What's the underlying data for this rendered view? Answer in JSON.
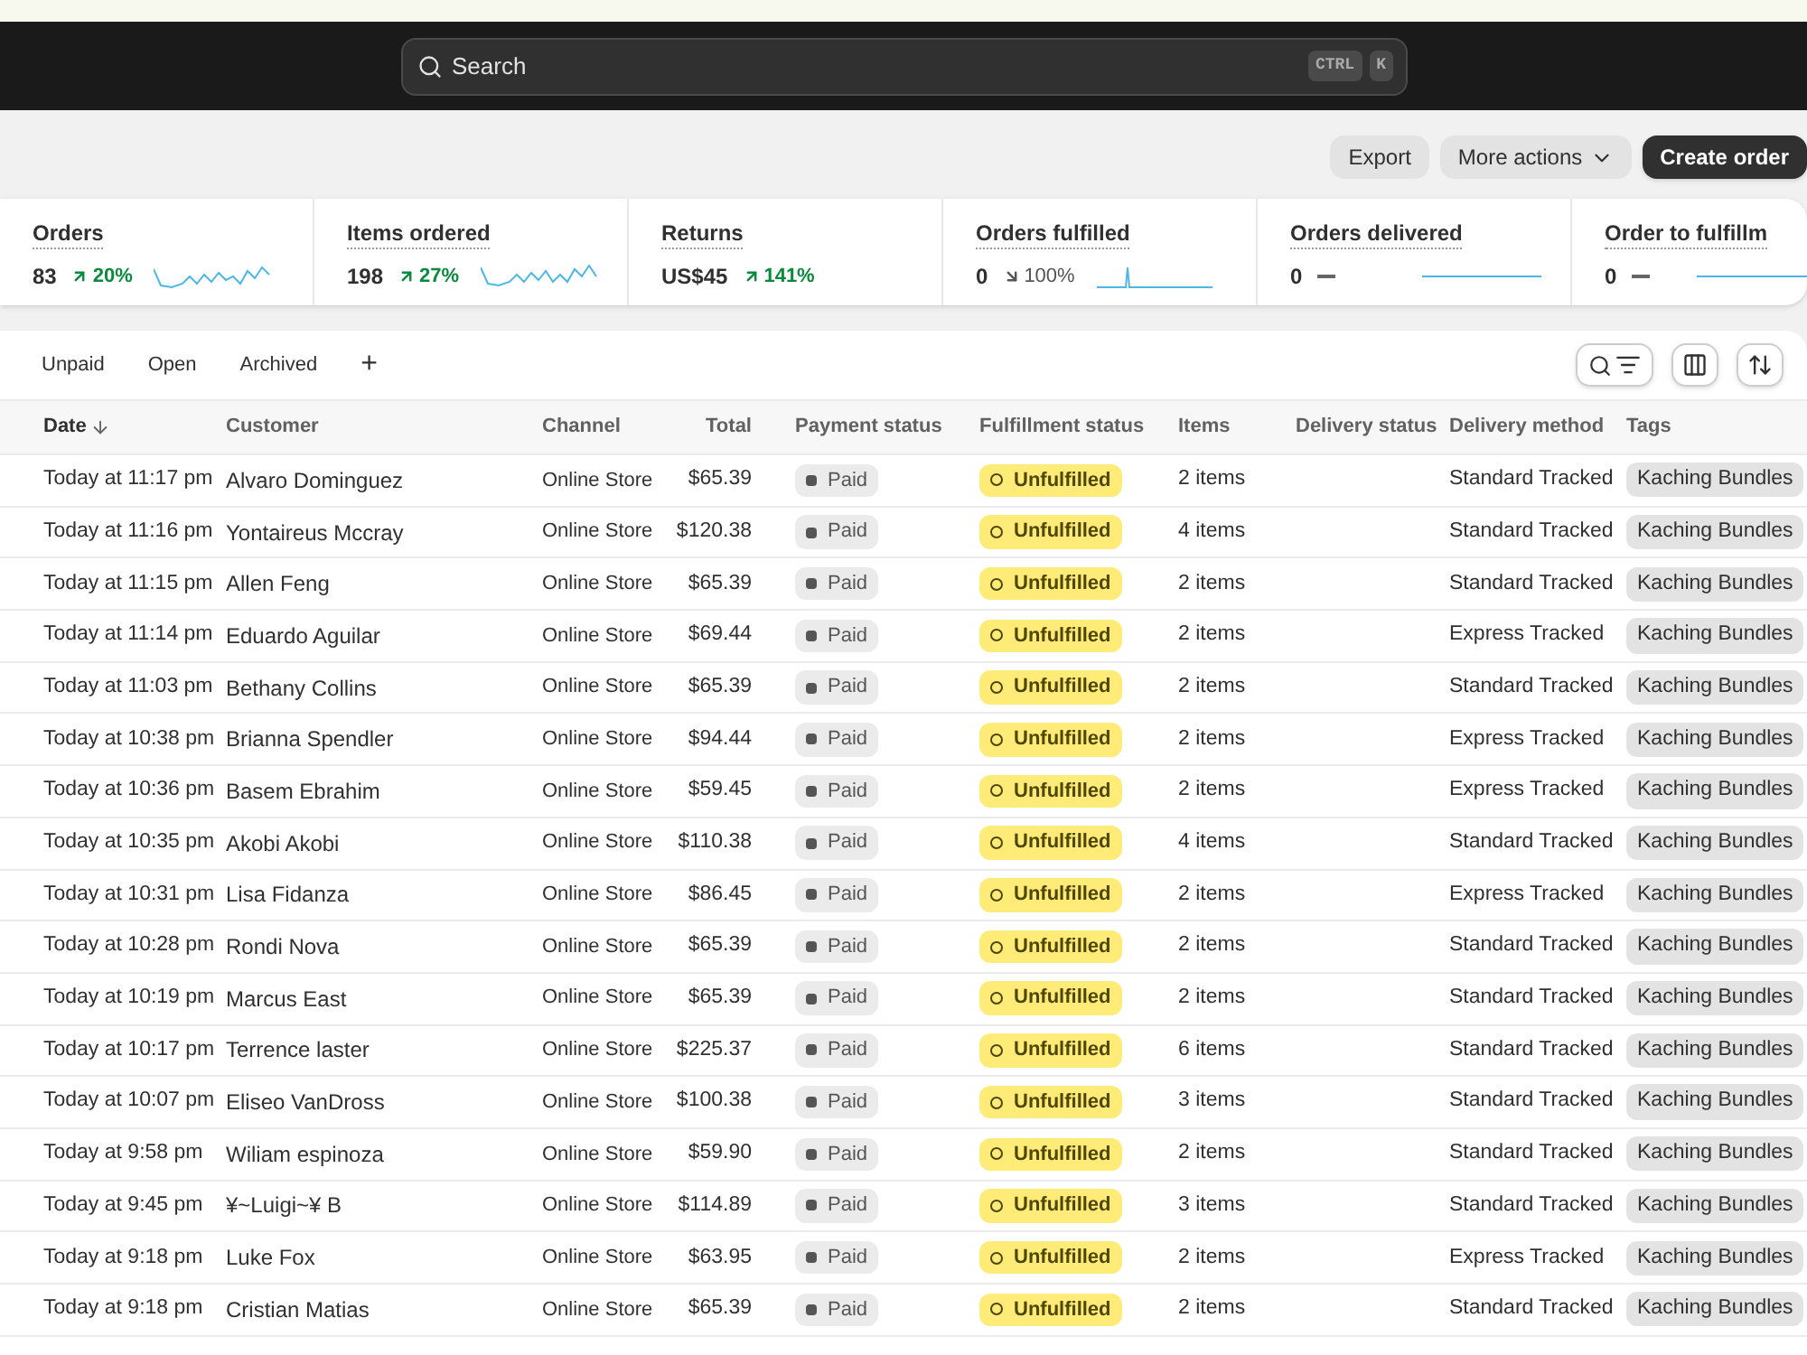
{
  "search": {
    "placeholder": "Search",
    "shortcut": [
      "CTRL",
      "K"
    ]
  },
  "actions": [
    {
      "label": "Export",
      "kind": "plain"
    },
    {
      "label": "More actions",
      "kind": "menu"
    },
    {
      "label": "Create order",
      "kind": "primary"
    }
  ],
  "metrics": [
    {
      "label": "Orders",
      "value": "83",
      "trend": {
        "kind": "up",
        "text": "20%"
      }
    },
    {
      "label": "Items ordered",
      "value": "198",
      "trend": {
        "kind": "up",
        "text": "27%"
      }
    },
    {
      "label": "Returns",
      "value": "US$45",
      "trend": {
        "kind": "up",
        "text": "141%"
      }
    },
    {
      "label": "Orders fulfilled",
      "value": "0",
      "trend": {
        "kind": "down",
        "text": "100%"
      }
    },
    {
      "label": "Orders delivered",
      "value": "0",
      "trend": {
        "kind": "none"
      }
    },
    {
      "label": "Order to fulfillm",
      "value": "0",
      "trend": {
        "kind": "none"
      }
    }
  ],
  "tabs": [
    {
      "label": "Unpaid",
      "selected": false
    },
    {
      "label": "Open",
      "selected": false
    },
    {
      "label": "Archived",
      "selected": false
    },
    {
      "label": "+",
      "selected": false
    }
  ],
  "table": {
    "columns": [
      {
        "label": "Date",
        "sorted": true
      },
      {
        "label": "Customer",
        "sorted": false
      },
      {
        "label": "Channel",
        "sorted": false
      },
      {
        "label": "Total",
        "sorted": false
      },
      {
        "label": "Payment status",
        "sorted": false
      },
      {
        "label": "Fulfillment status",
        "sorted": false
      },
      {
        "label": "Items",
        "sorted": false
      },
      {
        "label": "Delivery status",
        "sorted": false
      },
      {
        "label": "Delivery method",
        "sorted": false
      },
      {
        "label": "Tags",
        "sorted": false
      }
    ],
    "rows": [
      {
        "date": "Today at 11:17 pm",
        "customer": "Alvaro Dominguez",
        "channel": "Online Store",
        "total": "$65.39",
        "payment": "Paid",
        "fulfillment": "Unfulfilled",
        "items": "2 items",
        "method": "Standard Tracked",
        "tag": "Kaching Bundles"
      },
      {
        "date": "Today at 11:16 pm",
        "customer": "Yontaireus Mccray",
        "channel": "Online Store",
        "total": "$120.38",
        "payment": "Paid",
        "fulfillment": "Unfulfilled",
        "items": "4 items",
        "method": "Standard Tracked",
        "tag": "Kaching Bundles"
      },
      {
        "date": "Today at 11:15 pm",
        "customer": "Allen Feng",
        "channel": "Online Store",
        "total": "$65.39",
        "payment": "Paid",
        "fulfillment": "Unfulfilled",
        "items": "2 items",
        "method": "Standard Tracked",
        "tag": "Kaching Bundles"
      },
      {
        "date": "Today at 11:14 pm",
        "customer": "Eduardo Aguilar",
        "channel": "Online Store",
        "total": "$69.44",
        "payment": "Paid",
        "fulfillment": "Unfulfilled",
        "items": "2 items",
        "method": "Express Tracked",
        "tag": "Kaching Bundles"
      },
      {
        "date": "Today at 11:03 pm",
        "customer": "Bethany Collins",
        "channel": "Online Store",
        "total": "$65.39",
        "payment": "Paid",
        "fulfillment": "Unfulfilled",
        "items": "2 items",
        "method": "Standard Tracked",
        "tag": "Kaching Bundles"
      },
      {
        "date": "Today at 10:38 pm",
        "customer": "Brianna Spendler",
        "channel": "Online Store",
        "total": "$94.44",
        "payment": "Paid",
        "fulfillment": "Unfulfilled",
        "items": "2 items",
        "method": "Express Tracked",
        "tag": "Kaching Bundles"
      },
      {
        "date": "Today at 10:36 pm",
        "customer": "Basem Ebrahim",
        "channel": "Online Store",
        "total": "$59.45",
        "payment": "Paid",
        "fulfillment": "Unfulfilled",
        "items": "2 items",
        "method": "Express Tracked",
        "tag": "Kaching Bundles"
      },
      {
        "date": "Today at 10:35 pm",
        "customer": "Akobi Akobi",
        "channel": "Online Store",
        "total": "$110.38",
        "payment": "Paid",
        "fulfillment": "Unfulfilled",
        "items": "4 items",
        "method": "Standard Tracked",
        "tag": "Kaching Bundles"
      },
      {
        "date": "Today at 10:31 pm",
        "customer": "Lisa Fidanza",
        "channel": "Online Store",
        "total": "$86.45",
        "payment": "Paid",
        "fulfillment": "Unfulfilled",
        "items": "2 items",
        "method": "Express Tracked",
        "tag": "Kaching Bundles"
      },
      {
        "date": "Today at 10:28 pm",
        "customer": "Rondi Nova",
        "channel": "Online Store",
        "total": "$65.39",
        "payment": "Paid",
        "fulfillment": "Unfulfilled",
        "items": "2 items",
        "method": "Standard Tracked",
        "tag": "Kaching Bundles"
      },
      {
        "date": "Today at 10:19 pm",
        "customer": "Marcus East",
        "channel": "Online Store",
        "total": "$65.39",
        "payment": "Paid",
        "fulfillment": "Unfulfilled",
        "items": "2 items",
        "method": "Standard Tracked",
        "tag": "Kaching Bundles"
      },
      {
        "date": "Today at 10:17 pm",
        "customer": "Terrence laster",
        "channel": "Online Store",
        "total": "$225.37",
        "payment": "Paid",
        "fulfillment": "Unfulfilled",
        "items": "6 items",
        "method": "Standard Tracked",
        "tag": "Kaching Bundles"
      },
      {
        "date": "Today at 10:07 pm",
        "customer": "Eliseo VanDross",
        "channel": "Online Store",
        "total": "$100.38",
        "payment": "Paid",
        "fulfillment": "Unfulfilled",
        "items": "3 items",
        "method": "Standard Tracked",
        "tag": "Kaching Bundles"
      },
      {
        "date": "Today at 9:58 pm",
        "customer": "Wiliam espinoza",
        "channel": "Online Store",
        "total": "$59.90",
        "payment": "Paid",
        "fulfillment": "Unfulfilled",
        "items": "2 items",
        "method": "Standard Tracked",
        "tag": "Kaching Bundles"
      },
      {
        "date": "Today at 9:45 pm",
        "customer": "¥~Luigi~¥ B",
        "channel": "Online Store",
        "total": "$114.89",
        "payment": "Paid",
        "fulfillment": "Unfulfilled",
        "items": "3 items",
        "method": "Standard Tracked",
        "tag": "Kaching Bundles"
      },
      {
        "date": "Today at 9:18 pm",
        "customer": "Luke Fox",
        "channel": "Online Store",
        "total": "$63.95",
        "payment": "Paid",
        "fulfillment": "Unfulfilled",
        "items": "2 items",
        "method": "Express Tracked",
        "tag": "Kaching Bundles"
      },
      {
        "date": "Today at 9:18 pm",
        "customer": "Cristian Matias",
        "channel": "Online Store",
        "total": "$65.39",
        "payment": "Paid",
        "fulfillment": "Unfulfilled",
        "items": "2 items",
        "method": "Standard Tracked",
        "tag": "Kaching Bundles"
      }
    ]
  }
}
